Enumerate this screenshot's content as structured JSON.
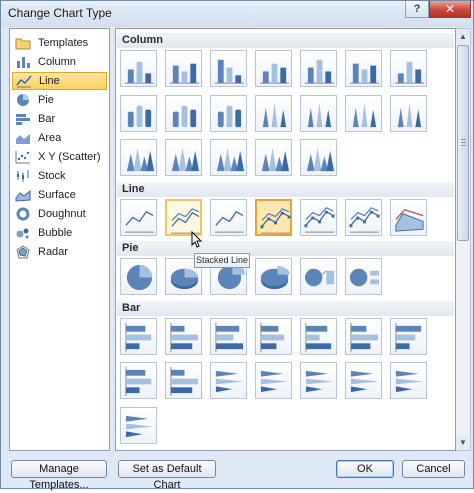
{
  "dialog": {
    "title": "Change Chart Type",
    "help_label": "?",
    "close_label": "✕"
  },
  "chart_types": [
    {
      "label": "Templates",
      "icon": "folder-icon"
    },
    {
      "label": "Column",
      "icon": "column-chart-icon"
    },
    {
      "label": "Line",
      "icon": "line-chart-icon",
      "selected": true
    },
    {
      "label": "Pie",
      "icon": "pie-chart-icon"
    },
    {
      "label": "Bar",
      "icon": "bar-chart-icon"
    },
    {
      "label": "Area",
      "icon": "area-chart-icon"
    },
    {
      "label": "X Y (Scatter)",
      "icon": "scatter-chart-icon"
    },
    {
      "label": "Stock",
      "icon": "stock-chart-icon"
    },
    {
      "label": "Surface",
      "icon": "surface-chart-icon"
    },
    {
      "label": "Doughnut",
      "icon": "doughnut-chart-icon"
    },
    {
      "label": "Bubble",
      "icon": "bubble-chart-icon"
    },
    {
      "label": "Radar",
      "icon": "radar-chart-icon"
    }
  ],
  "gallery": {
    "sections": [
      {
        "name": "Column",
        "rows": [
          7,
          7,
          5
        ]
      },
      {
        "name": "Line",
        "rows": [
          7
        ]
      },
      {
        "name": "Pie",
        "rows": [
          6
        ]
      },
      {
        "name": "Bar",
        "rows": [
          7,
          7,
          1
        ]
      }
    ],
    "hovered": "Stacked Line",
    "selected": "Line with Markers"
  },
  "tooltip": "Stacked Line",
  "buttons": {
    "manage_templates": "Manage Templates...",
    "set_default": "Set as Default Chart",
    "ok": "OK",
    "cancel": "Cancel"
  },
  "colors": {
    "accent": "#4f81bd",
    "selection": "#fbcf5e",
    "chart_blue": "#5b84b9"
  }
}
